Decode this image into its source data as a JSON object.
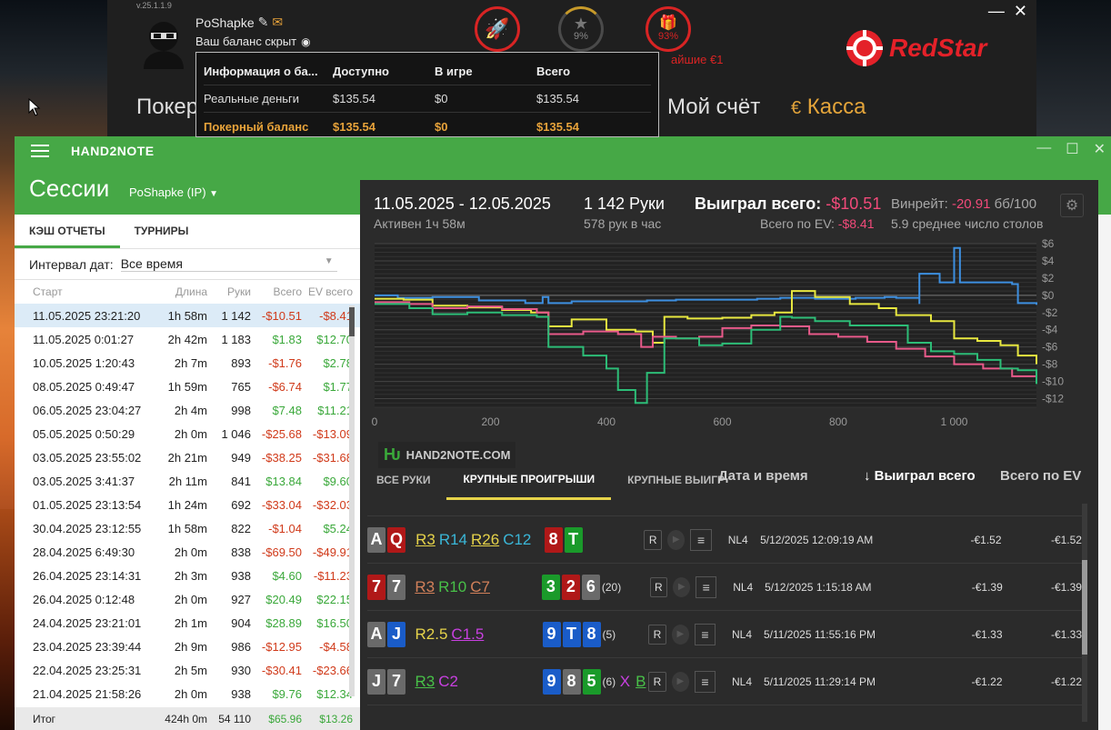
{
  "poker": {
    "version": "v.25.1.1.9",
    "nickname": "PoShapke",
    "balance_hidden": "Ваш баланс скрыт",
    "star_pct": "9%",
    "gift_pct": "93%",
    "promo": "айшие €1",
    "brand": "RedStar",
    "nav_left": "Покер",
    "nav_account": "Мой счёт",
    "nav_cashier": "Касса"
  },
  "balance_popup": {
    "headers": [
      "Информация о ба...",
      "Доступно",
      "В игре",
      "Всего"
    ],
    "rows": [
      [
        "Реальные деньги",
        "$135.54",
        "$0",
        "$135.54"
      ],
      [
        "Покерный баланс",
        "$135.54",
        "$0",
        "$135.54"
      ]
    ]
  },
  "app": {
    "title": "HAND2NOTE",
    "section_title": "Сессии",
    "player": "PoShapke (IP)",
    "tabs": [
      "КЭШ ОТЧЕТЫ",
      "ТУРНИРЫ"
    ],
    "interval_label": "Интервал дат:",
    "interval_value": "Все время"
  },
  "sessions": {
    "columns": [
      "Старт",
      "Длина",
      "Руки",
      "Всего",
      "EV всего"
    ],
    "rows": [
      [
        "11.05.2025 23:21:20",
        "1h 58m",
        "1 142",
        "-$10.51",
        "-$8.41"
      ],
      [
        "11.05.2025 0:01:27",
        "2h 42m",
        "1 183",
        "$1.83",
        "$12.70"
      ],
      [
        "10.05.2025 1:20:43",
        "2h 7m",
        "893",
        "-$1.76",
        "$2.78"
      ],
      [
        "08.05.2025 0:49:47",
        "1h 59m",
        "765",
        "-$6.74",
        "$1.77"
      ],
      [
        "06.05.2025 23:04:27",
        "2h 4m",
        "998",
        "$7.48",
        "$11.21"
      ],
      [
        "05.05.2025 0:50:29",
        "2h 0m",
        "1 046",
        "-$25.68",
        "-$13.09"
      ],
      [
        "03.05.2025 23:55:02",
        "2h 21m",
        "949",
        "-$38.25",
        "-$31.68"
      ],
      [
        "03.05.2025 3:41:37",
        "2h 11m",
        "841",
        "$13.84",
        "$9.60"
      ],
      [
        "01.05.2025 23:13:54",
        "1h 24m",
        "692",
        "-$33.04",
        "-$32.03"
      ],
      [
        "30.04.2025 23:12:55",
        "1h 58m",
        "822",
        "-$1.04",
        "$5.24"
      ],
      [
        "28.04.2025 6:49:30",
        "2h 0m",
        "838",
        "-$69.50",
        "-$49.91"
      ],
      [
        "26.04.2025 23:14:31",
        "2h 3m",
        "938",
        "$4.60",
        "-$11.23"
      ],
      [
        "26.04.2025 0:12:48",
        "2h 0m",
        "927",
        "$20.49",
        "$22.15"
      ],
      [
        "24.04.2025 23:21:01",
        "2h 1m",
        "904",
        "$28.89",
        "$16.50"
      ],
      [
        "23.04.2025 23:39:44",
        "2h 9m",
        "986",
        "-$12.95",
        "-$4.58"
      ],
      [
        "22.04.2025 23:25:31",
        "2h 5m",
        "930",
        "-$30.41",
        "-$23.66"
      ],
      [
        "21.04.2025 21:58:26",
        "2h 0m",
        "938",
        "$9.76",
        "$12.34"
      ]
    ],
    "total": [
      "Итог",
      "424h 0m",
      "54 110",
      "$65.96",
      "$13.26"
    ]
  },
  "summary": {
    "dates": "11.05.2025 - 12.05.2025",
    "active": "Активен 1ч 58м",
    "hands_label": "1 142 Руки",
    "hands_per_hour": "578 рук в час",
    "won_label": "Выиграл всего:",
    "won_value": "-$10.51",
    "ev_label": "Всего по EV:",
    "ev_value": "-$8.41",
    "winrate_label": "Винрейт:",
    "winrate_value": "-20.91",
    "winrate_unit": "бб/100",
    "tables": "5.9 среднее число столов"
  },
  "watermark": "HAND2NOTE.COM",
  "chart_data": {
    "type": "line",
    "x_ticks": [
      "0",
      "200",
      "400",
      "600",
      "800",
      "1 000"
    ],
    "y_ticks": [
      "$6",
      "$4",
      "$2",
      "$0",
      "-$2",
      "-$4",
      "-$6",
      "-$8",
      "-$10",
      "-$12"
    ],
    "xlim": [
      0,
      1142
    ],
    "ylim": [
      -13,
      6
    ],
    "grid": true,
    "series": [
      {
        "color": "#3d8fe0",
        "points": [
          [
            0,
            0
          ],
          [
            40,
            -0.3
          ],
          [
            100,
            -0.2
          ],
          [
            180,
            -0.6
          ],
          [
            260,
            -0.9
          ],
          [
            290,
            -0.2
          ],
          [
            300,
            -0.9
          ],
          [
            340,
            -0.7
          ],
          [
            420,
            -0.7
          ],
          [
            470,
            -0.6
          ],
          [
            520,
            -0.5
          ],
          [
            560,
            -0.5
          ],
          [
            620,
            -0.5
          ],
          [
            660,
            -0.4
          ],
          [
            700,
            -0.3
          ],
          [
            760,
            -0.4
          ],
          [
            830,
            -0.3
          ],
          [
            880,
            -0.2
          ],
          [
            900,
            -0.3
          ],
          [
            930,
            -0.3
          ],
          [
            940,
            -1
          ],
          [
            940,
            2.5
          ],
          [
            960,
            2.5
          ],
          [
            975,
            1.5
          ],
          [
            1000,
            1.5
          ],
          [
            1000,
            5.5
          ],
          [
            1010,
            5.5
          ],
          [
            1010,
            1.5
          ],
          [
            1060,
            1.5
          ],
          [
            1100,
            1.3
          ],
          [
            1110,
            -0.9
          ],
          [
            1142,
            -1.1
          ]
        ]
      },
      {
        "color": "#e8e840",
        "points": [
          [
            0,
            -0.4
          ],
          [
            50,
            -0.5
          ],
          [
            100,
            -1.2
          ],
          [
            160,
            -1.4
          ],
          [
            220,
            -1.7
          ],
          [
            270,
            -2
          ],
          [
            300,
            -3.6
          ],
          [
            340,
            -2.8
          ],
          [
            400,
            -4
          ],
          [
            450,
            -4.2
          ],
          [
            480,
            -5.5
          ],
          [
            500,
            -2.5
          ],
          [
            540,
            -2.7
          ],
          [
            600,
            -2.6
          ],
          [
            650,
            -2.3
          ],
          [
            690,
            -2
          ],
          [
            720,
            0.5
          ],
          [
            760,
            -0.2
          ],
          [
            820,
            -1
          ],
          [
            870,
            -1.5
          ],
          [
            900,
            -2.3
          ],
          [
            960,
            -3
          ],
          [
            1000,
            -5
          ],
          [
            1040,
            -5.3
          ],
          [
            1080,
            -5.8
          ],
          [
            1110,
            -7
          ],
          [
            1142,
            -8
          ]
        ]
      },
      {
        "color": "#e85a8a",
        "points": [
          [
            0,
            -0.8
          ],
          [
            60,
            -1
          ],
          [
            100,
            -1.5
          ],
          [
            160,
            -1.3
          ],
          [
            220,
            -1.6
          ],
          [
            280,
            -2
          ],
          [
            300,
            -4.5
          ],
          [
            360,
            -4.2
          ],
          [
            420,
            -4.5
          ],
          [
            460,
            -6
          ],
          [
            480,
            -4.8
          ],
          [
            520,
            -5
          ],
          [
            560,
            -4.8
          ],
          [
            600,
            -3.8
          ],
          [
            650,
            -3.5
          ],
          [
            700,
            -3.6
          ],
          [
            750,
            -4.5
          ],
          [
            800,
            -4.8
          ],
          [
            850,
            -5.4
          ],
          [
            900,
            -6.2
          ],
          [
            950,
            -7.1
          ],
          [
            1000,
            -8
          ],
          [
            1050,
            -8.5
          ],
          [
            1100,
            -9.4
          ],
          [
            1142,
            -9.8
          ]
        ]
      },
      {
        "color": "#2dbd77",
        "points": [
          [
            0,
            -1
          ],
          [
            60,
            -1.5
          ],
          [
            100,
            -2.2
          ],
          [
            160,
            -2
          ],
          [
            220,
            -2.3
          ],
          [
            280,
            -2.5
          ],
          [
            300,
            -6
          ],
          [
            360,
            -7
          ],
          [
            400,
            -8.5
          ],
          [
            420,
            -11
          ],
          [
            450,
            -12.5
          ],
          [
            470,
            -9
          ],
          [
            500,
            -5
          ],
          [
            560,
            -5.8
          ],
          [
            600,
            -5.6
          ],
          [
            650,
            -4
          ],
          [
            700,
            -2.5
          ],
          [
            720,
            -2.6
          ],
          [
            760,
            -3
          ],
          [
            820,
            -3.5
          ],
          [
            860,
            -3.5
          ],
          [
            920,
            -5.5
          ],
          [
            960,
            -6.5
          ],
          [
            1000,
            -6.8
          ],
          [
            1040,
            -7.5
          ],
          [
            1080,
            -8.5
          ],
          [
            1110,
            -8.7
          ],
          [
            1142,
            -10.3
          ]
        ]
      }
    ]
  },
  "hands_tabs": [
    "ВСЕ РУКИ",
    "КРУПНЫЕ ПРОИГРЫШИ",
    "КРУПНЫЕ ВЫИГР"
  ],
  "hands_columns": [
    "Дата и время",
    "↓ Выиграл всего",
    "Всего по EV"
  ],
  "hands": [
    {
      "cards": [
        [
          "A",
          "cg"
        ],
        [
          "Q",
          "cr"
        ]
      ],
      "actions": [
        [
          "R3",
          "#e6d34a",
          true
        ],
        [
          "R14",
          "#3ab7d8",
          false
        ],
        [
          "R26",
          "#e6d34a",
          true
        ],
        [
          "C12",
          "#3ab7d8",
          false
        ]
      ],
      "board": [
        [
          "8",
          "cr"
        ],
        [
          "T",
          "cgr"
        ]
      ],
      "players": "",
      "extra": [],
      "stake": "NL4",
      "time": "5/12/2025 12:09:19 AM",
      "won": "-€1.52",
      "ev": "-€1.52"
    },
    {
      "cards": [
        [
          "7",
          "cr"
        ],
        [
          "7",
          "cg"
        ]
      ],
      "actions": [
        [
          "R3",
          "#d2805a",
          true
        ],
        [
          "R10",
          "#48c048",
          false
        ],
        [
          "C7",
          "#d2805a",
          true
        ]
      ],
      "board": [
        [
          "3",
          "cgr"
        ],
        [
          "2",
          "cr"
        ],
        [
          "6",
          "cg"
        ]
      ],
      "players": "(20)",
      "extra": [],
      "stake": "NL4",
      "time": "5/12/2025 1:15:18 AM",
      "won": "-€1.39",
      "ev": "-€1.39"
    },
    {
      "cards": [
        [
          "A",
          "cg"
        ],
        [
          "J",
          "cb"
        ]
      ],
      "actions": [
        [
          "R2.5",
          "#e6d34a",
          false
        ],
        [
          "C1.5",
          "#c840e0",
          true
        ]
      ],
      "board": [
        [
          "9",
          "cb"
        ],
        [
          "T",
          "cb"
        ],
        [
          "8",
          "cb"
        ]
      ],
      "players": "(5)",
      "extra": [],
      "stake": "NL4",
      "time": "5/11/2025 11:55:16 PM",
      "won": "-€1.33",
      "ev": "-€1.33"
    },
    {
      "cards": [
        [
          "J",
          "cg"
        ],
        [
          "7",
          "cg"
        ]
      ],
      "actions": [
        [
          "R3",
          "#48c048",
          true
        ],
        [
          "C2",
          "#c840e0",
          false
        ]
      ],
      "board": [
        [
          "9",
          "cb"
        ],
        [
          "8",
          "cg"
        ],
        [
          "5",
          "cgr"
        ]
      ],
      "players": "(6)",
      "extra": [
        [
          "X",
          "#c840e0",
          false
        ],
        [
          "B",
          "#48c048",
          true
        ]
      ],
      "stake": "NL4",
      "time": "5/11/2025 11:29:14 PM",
      "won": "-€1.22",
      "ev": "-€1.22"
    }
  ]
}
